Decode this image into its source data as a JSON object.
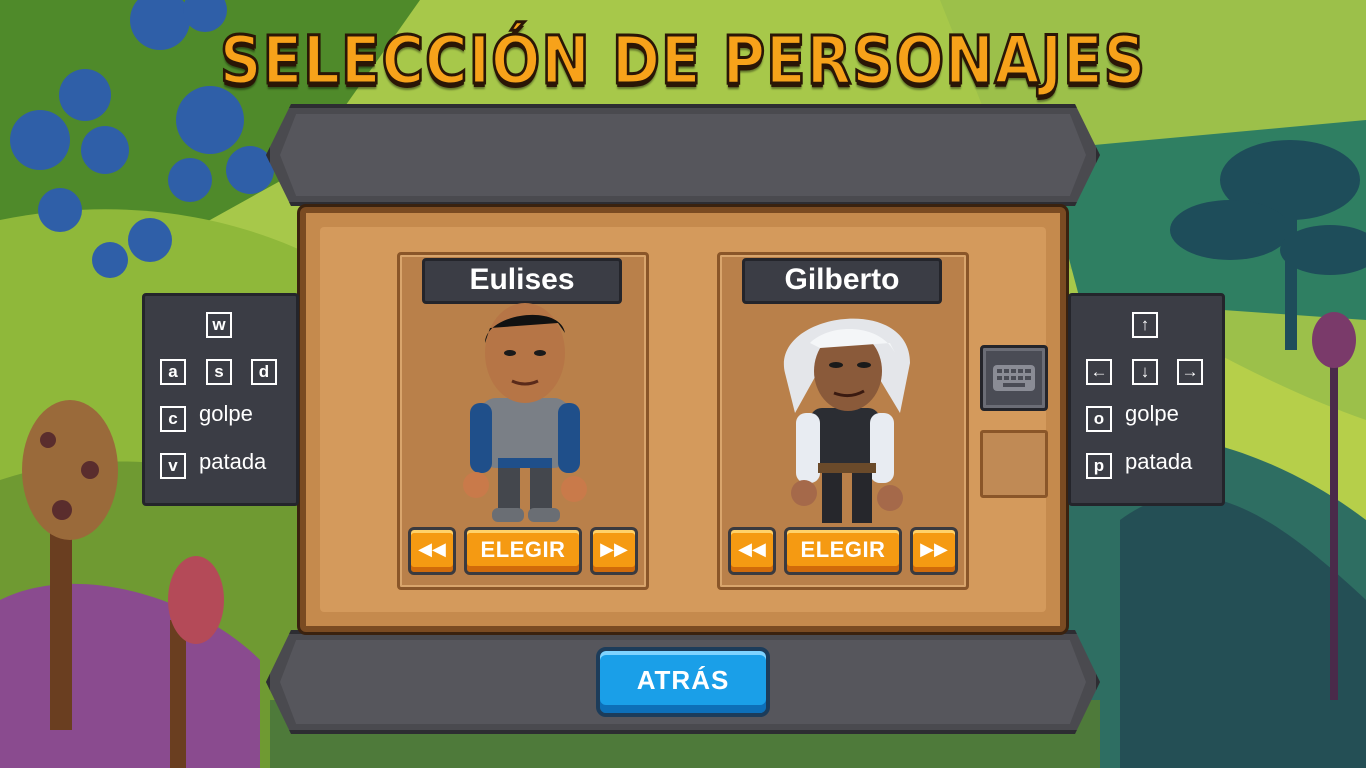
{
  "title": "SELECCIÓN DE PERSONAJES",
  "player1": {
    "name": "Eulises",
    "select_label": "ELEGIR",
    "prev_icon": "rewind-icon",
    "next_icon": "fast-forward-icon"
  },
  "player2": {
    "name": "Gilberto",
    "select_label": "ELEGIR",
    "prev_icon": "rewind-icon",
    "next_icon": "fast-forward-icon"
  },
  "controls_left": {
    "up": "w",
    "left": "a",
    "down": "s",
    "right": "d",
    "punch_key": "c",
    "punch_label": "golpe",
    "kick_key": "v",
    "kick_label": "patada"
  },
  "controls_right": {
    "up": "↑",
    "left": "←",
    "down": "↓",
    "right": "→",
    "punch_key": "o",
    "punch_label": "golpe",
    "kick_key": "p",
    "kick_label": "patada"
  },
  "back_label": "ATRÁS",
  "colors": {
    "orange": "#f59a12",
    "blue": "#1a9fe8",
    "stone": "#4a4a4f",
    "wood": "#c58a4d"
  }
}
